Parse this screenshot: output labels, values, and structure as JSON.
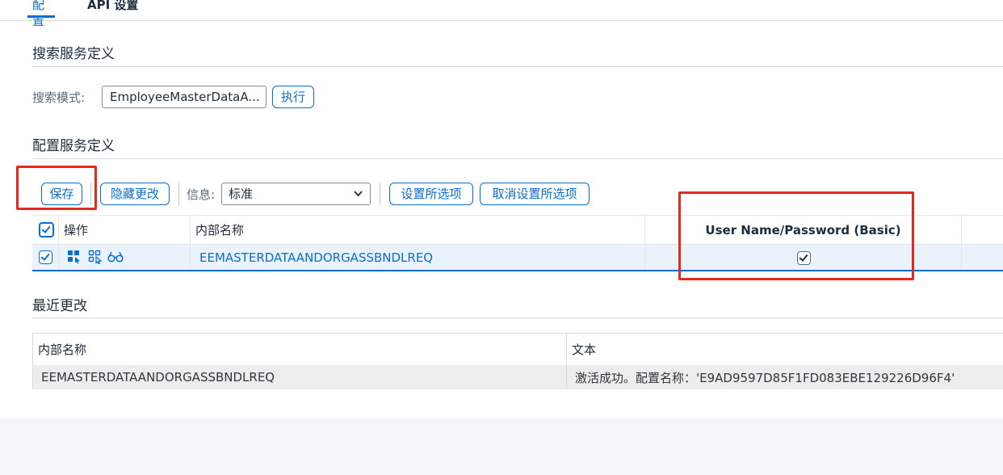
{
  "tabs": {
    "config": "配置",
    "api": "API 设置"
  },
  "search_section": {
    "title": "搜索服务定义",
    "mode_label": "搜索模式:",
    "mode_value": "EmployeeMasterDataA...",
    "execute": "执行"
  },
  "config_section": {
    "title": "配置服务定义",
    "toolbar": {
      "save": "保存",
      "hide_changes": "隐藏更改",
      "info_label": "信息:",
      "info_value": "标准",
      "select_all": "设置所选项",
      "deselect_all": "取消设置所选项"
    },
    "table": {
      "columns": {
        "action": "操作",
        "internal_name": "内部名称",
        "auth": "User Name/Password (Basic)"
      },
      "rows": [
        {
          "internal_name": "EEMASTERDATAANDORGASSBNDLREQ",
          "selected": true,
          "auth_checked": true
        }
      ]
    }
  },
  "recent_section": {
    "title": "最近更改",
    "columns": {
      "internal_name": "内部名称",
      "text": "文本"
    },
    "rows": [
      {
        "internal_name": "EEMASTERDATAANDORGASSBNDLREQ",
        "text": "激活成功。配置名称：'E9AD9597D85F1FD083EBE129226D96F4'"
      }
    ]
  },
  "colors": {
    "accent": "#0a6ed1",
    "highlight": "#e8271d",
    "row_selected": "#eaf3fc"
  }
}
